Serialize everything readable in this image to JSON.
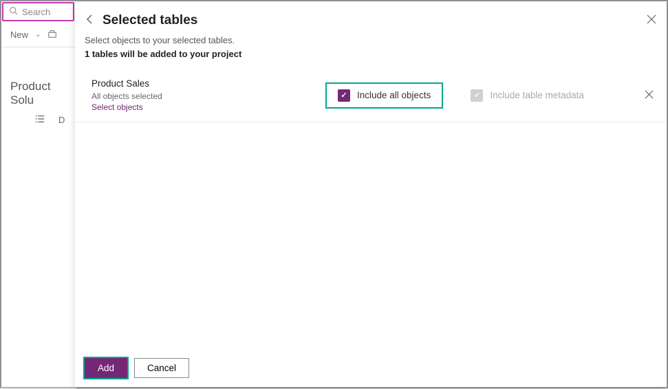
{
  "background": {
    "search_placeholder": "Search",
    "new_label": "New",
    "page_title": "Product Solu",
    "row_label": "D"
  },
  "panel": {
    "title": "Selected tables",
    "desc_line1": "Select objects to your selected tables.",
    "desc_line2": "1 tables will be added to your project",
    "tables": [
      {
        "name": "Product Sales",
        "subtitle": "All objects selected",
        "link": "Select objects",
        "include_all_label": "Include all objects",
        "include_all_checked": true,
        "metadata_label": "Include table metadata",
        "metadata_enabled": false
      }
    ],
    "footer": {
      "primary": "Add",
      "secondary": "Cancel"
    }
  }
}
